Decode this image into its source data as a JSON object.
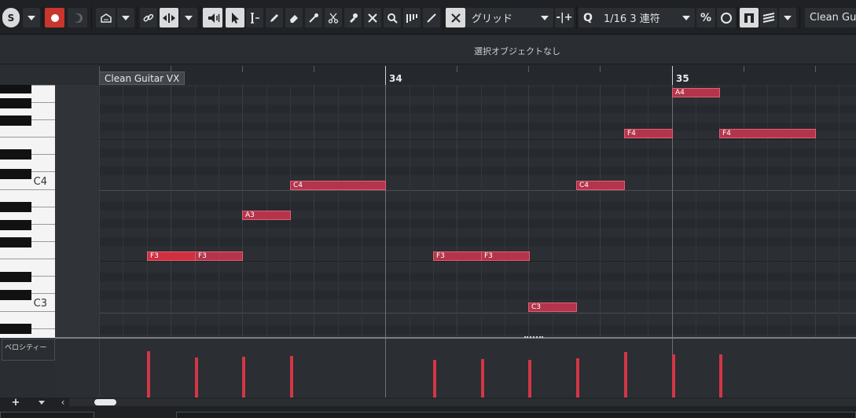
{
  "toolbar": {
    "quantize_preset": "グリッド",
    "quantize_value": "1/16 3 連符",
    "track_name": "Clean Guit"
  },
  "info_line": {
    "text": "選択オブジェクトなし"
  },
  "ruler": {
    "bar_34": "34",
    "bar_35": "35",
    "part_name": "Clean Guitar VX"
  },
  "keyboard": {
    "c4_label": "C4",
    "c3_label": "C3"
  },
  "notes": [
    {
      "pitch": "F3",
      "bar_position": "33.2.1",
      "length": "1/16 triplet x2",
      "velocity": 100,
      "selected": true
    },
    {
      "pitch": "F3",
      "bar_position": "33.2.3",
      "length": "1/16 triplet x2",
      "velocity": 86
    },
    {
      "pitch": "A3",
      "bar_position": "33.3.1",
      "length": "1/16 triplet x2",
      "velocity": 88
    },
    {
      "pitch": "C4",
      "bar_position": "33.3.3",
      "length": "1/16 triplet x4",
      "velocity": 90
    },
    {
      "pitch": "F3",
      "bar_position": "34.2.1",
      "length": "1/16 triplet x2",
      "velocity": 82
    },
    {
      "pitch": "F3",
      "bar_position": "34.2.3",
      "length": "1/16 triplet x2",
      "velocity": 83
    },
    {
      "pitch": "C3",
      "bar_position": "34.3.1",
      "length": "1/16 triplet x2",
      "velocity": 82
    },
    {
      "pitch": "C4",
      "bar_position": "34.3.3",
      "length": "1/16 triplet x2",
      "velocity": 84
    },
    {
      "pitch": "F4",
      "bar_position": "34.4.1",
      "length": "1/16 triplet x2",
      "velocity": 98
    },
    {
      "pitch": "A4",
      "bar_position": "34.4.3",
      "length": "1/16 triplet x2",
      "velocity": 93
    },
    {
      "pitch": "F4",
      "bar_position": "35.1.2",
      "length": "1/16 triplet x4",
      "velocity": 93
    }
  ],
  "velocity_lane": {
    "label": "ベロシティー"
  },
  "bottom": {
    "add_label": "+"
  },
  "colors": {
    "note_fill": "#b4354b",
    "note_selected": "#cf2f3f",
    "velocity": "#d33646",
    "record": "#c8362c"
  },
  "icons": [
    "solo-icon",
    "record-icon",
    "monitor-icon",
    "trackfolder-icon",
    "link-icon",
    "autoscroll-icon",
    "speaker-icon",
    "arrow-tool-icon",
    "range-tool-icon",
    "pencil-icon",
    "eraser-icon",
    "trim-icon",
    "split-icon",
    "glue-icon",
    "mute-tool-icon",
    "zoom-icon",
    "comb-icon",
    "line-icon",
    "snap-icon",
    "quantize-icon",
    "iterative-icon",
    "editor-icon",
    "stack-icon"
  ]
}
